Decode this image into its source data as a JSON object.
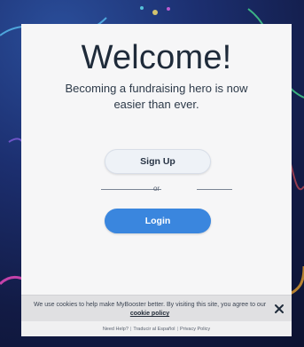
{
  "welcome": {
    "title": "Welcome!",
    "subtitle": "Becoming a fundraising hero is now easier than ever."
  },
  "auth": {
    "signup_label": "Sign Up",
    "or_label": "or",
    "login_label": "Login"
  },
  "cookie_banner": {
    "text": "We use cookies to help make MyBooster better. By visiting this site, you agree to our",
    "link_text": "cookie policy",
    "close_icon": "close-icon"
  },
  "footer": {
    "help": "Need Help?",
    "spanish": "Traducir al Español",
    "privacy": "Privacy Policy",
    "separator": "|"
  },
  "colors": {
    "primary": "#3a86de",
    "card_bg": "#f6f6f7",
    "text_dark": "#1f2b3a",
    "cookie_bg": "#e0e0e2"
  },
  "icons": {
    "background": "neon-party-background"
  }
}
